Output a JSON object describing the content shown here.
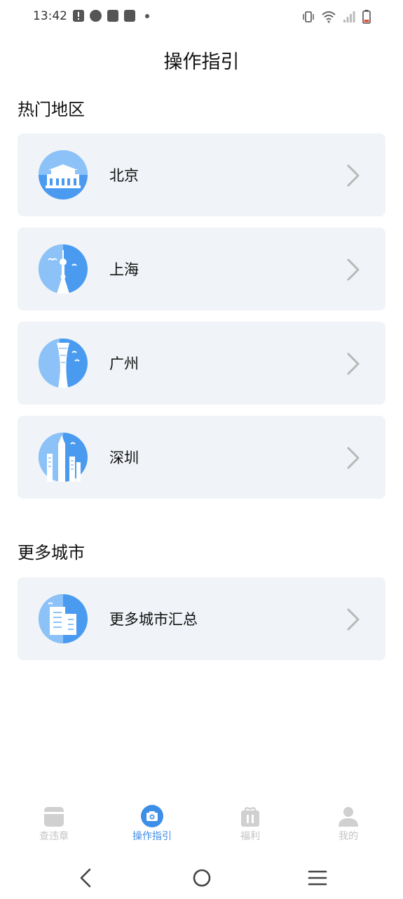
{
  "status_bar": {
    "time": "13:42"
  },
  "page": {
    "title": "操作指引"
  },
  "sections": [
    {
      "title": "热门地区",
      "items": [
        {
          "label": "北京",
          "icon": "beijing-gate-icon"
        },
        {
          "label": "上海",
          "icon": "shanghai-tower-icon"
        },
        {
          "label": "广州",
          "icon": "guangzhou-tower-icon"
        },
        {
          "label": "深圳",
          "icon": "shenzhen-skyline-icon"
        }
      ]
    },
    {
      "title": "更多城市",
      "items": [
        {
          "label": "更多城市汇总",
          "icon": "buildings-icon"
        }
      ]
    }
  ],
  "tab_bar": {
    "tabs": [
      {
        "label": "查违章",
        "icon": "ticket-icon",
        "active": false
      },
      {
        "label": "操作指引",
        "icon": "camera-icon",
        "active": true
      },
      {
        "label": "福利",
        "icon": "gift-icon",
        "active": false
      },
      {
        "label": "我的",
        "icon": "person-icon",
        "active": false
      }
    ]
  },
  "colors": {
    "accent": "#3d8ee6",
    "icon_blue": "#4a9bf0",
    "icon_light": "#8cc2f7",
    "card_bg": "#f0f3f7",
    "tab_inactive": "#c4c4c4",
    "chevron": "#b8b8b8"
  }
}
